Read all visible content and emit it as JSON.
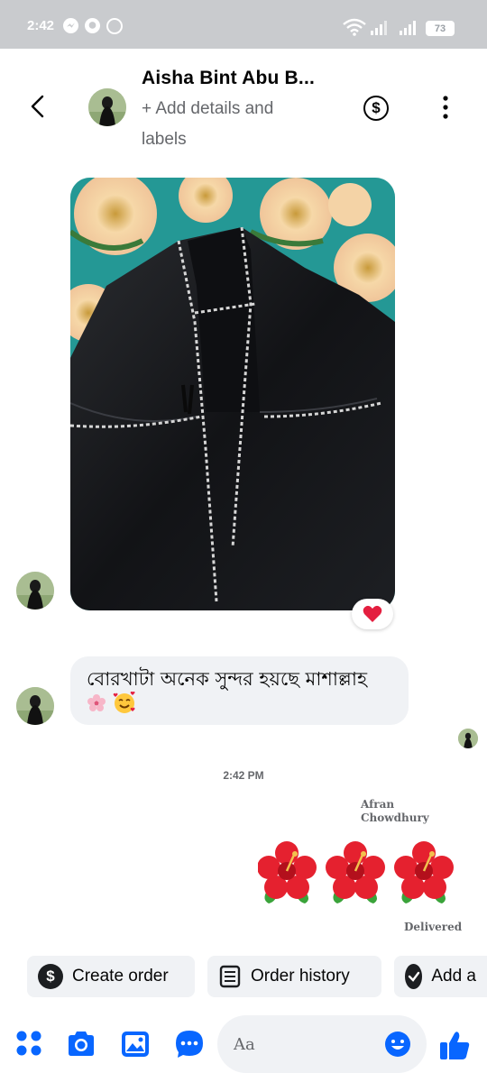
{
  "status_bar": {
    "time": "2:42",
    "battery": "73"
  },
  "header": {
    "contact_name": "Aisha Bint Abu B...",
    "subtitle": "+ Add details and labels"
  },
  "messages": {
    "incoming_text": "বোরখাটা অনেক সুন্দর হয়ছে মাশাল্লাহ",
    "timestamp": "2:42 PM",
    "outgoing_sender": "Afran Chowdhury",
    "outgoing_status": "Delivered"
  },
  "chips": [
    {
      "label": "Create order",
      "icon": "dollar-icon"
    },
    {
      "label": "Order history",
      "icon": "receipt-icon"
    },
    {
      "label": "Add a",
      "icon": "check-icon"
    }
  ],
  "composer": {
    "placeholder": "Aa"
  },
  "colors": {
    "accent": "#0866ff",
    "bubble": "#f0f2f5",
    "secondary_text": "#65676b"
  }
}
